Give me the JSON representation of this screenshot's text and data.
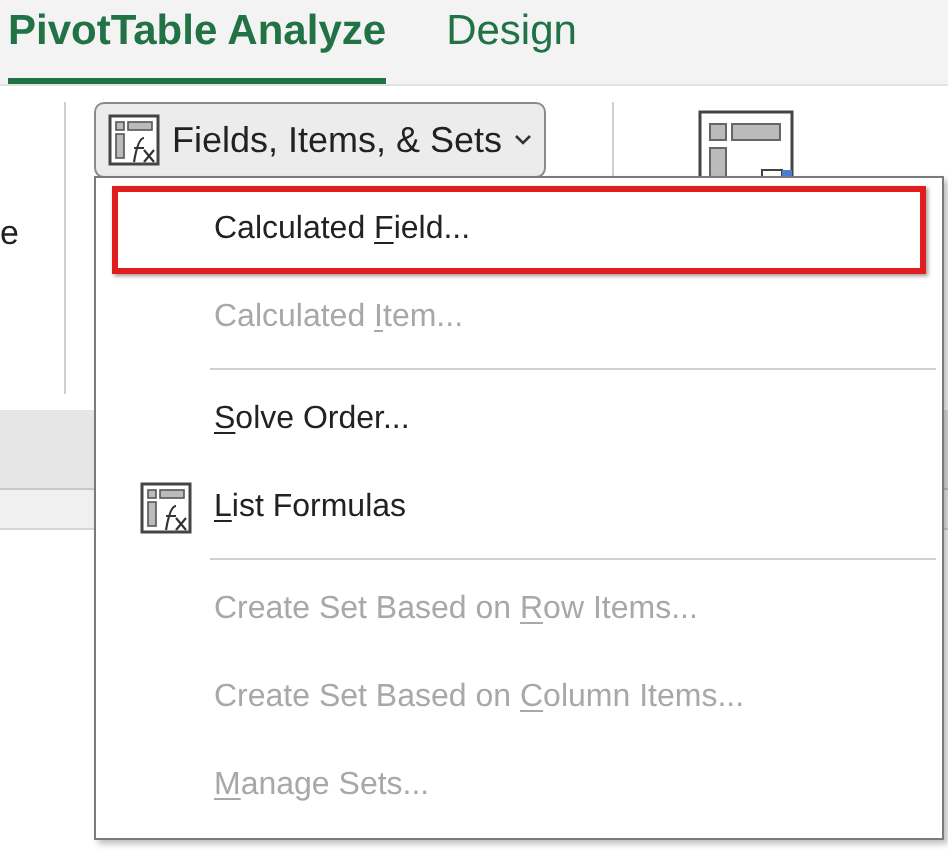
{
  "tabs": [
    {
      "label": "PivotTable Analyze",
      "selected": true
    },
    {
      "label": "Design",
      "selected": false
    }
  ],
  "ribbon": {
    "cut_label": "e",
    "button": {
      "label": "Fields, Items, & Sets",
      "expanded": true
    }
  },
  "menu": {
    "items": [
      {
        "kind": "item",
        "before": "Calculated ",
        "key": "F",
        "after": "ield...",
        "disabled": false,
        "highlighted": true,
        "icon": false
      },
      {
        "kind": "item",
        "before": "Calculated ",
        "key": "I",
        "after": "tem...",
        "disabled": true,
        "highlighted": false,
        "icon": false
      },
      {
        "kind": "separator"
      },
      {
        "kind": "item",
        "key": "S",
        "after": "olve Order...",
        "disabled": false,
        "highlighted": false,
        "icon": false
      },
      {
        "kind": "item",
        "key": "L",
        "after": "ist Formulas",
        "disabled": false,
        "highlighted": false,
        "icon": true
      },
      {
        "kind": "separator"
      },
      {
        "kind": "item",
        "before": "Create Set Based on ",
        "key": "R",
        "after": "ow Items...",
        "disabled": true,
        "highlighted": false,
        "icon": false
      },
      {
        "kind": "item",
        "before": "Create Set Based on ",
        "key": "C",
        "after": "olumn Items...",
        "disabled": true,
        "highlighted": false,
        "icon": false
      },
      {
        "kind": "item",
        "key": "M",
        "after": "anage Sets...",
        "disabled": true,
        "highlighted": false,
        "icon": false
      }
    ]
  }
}
